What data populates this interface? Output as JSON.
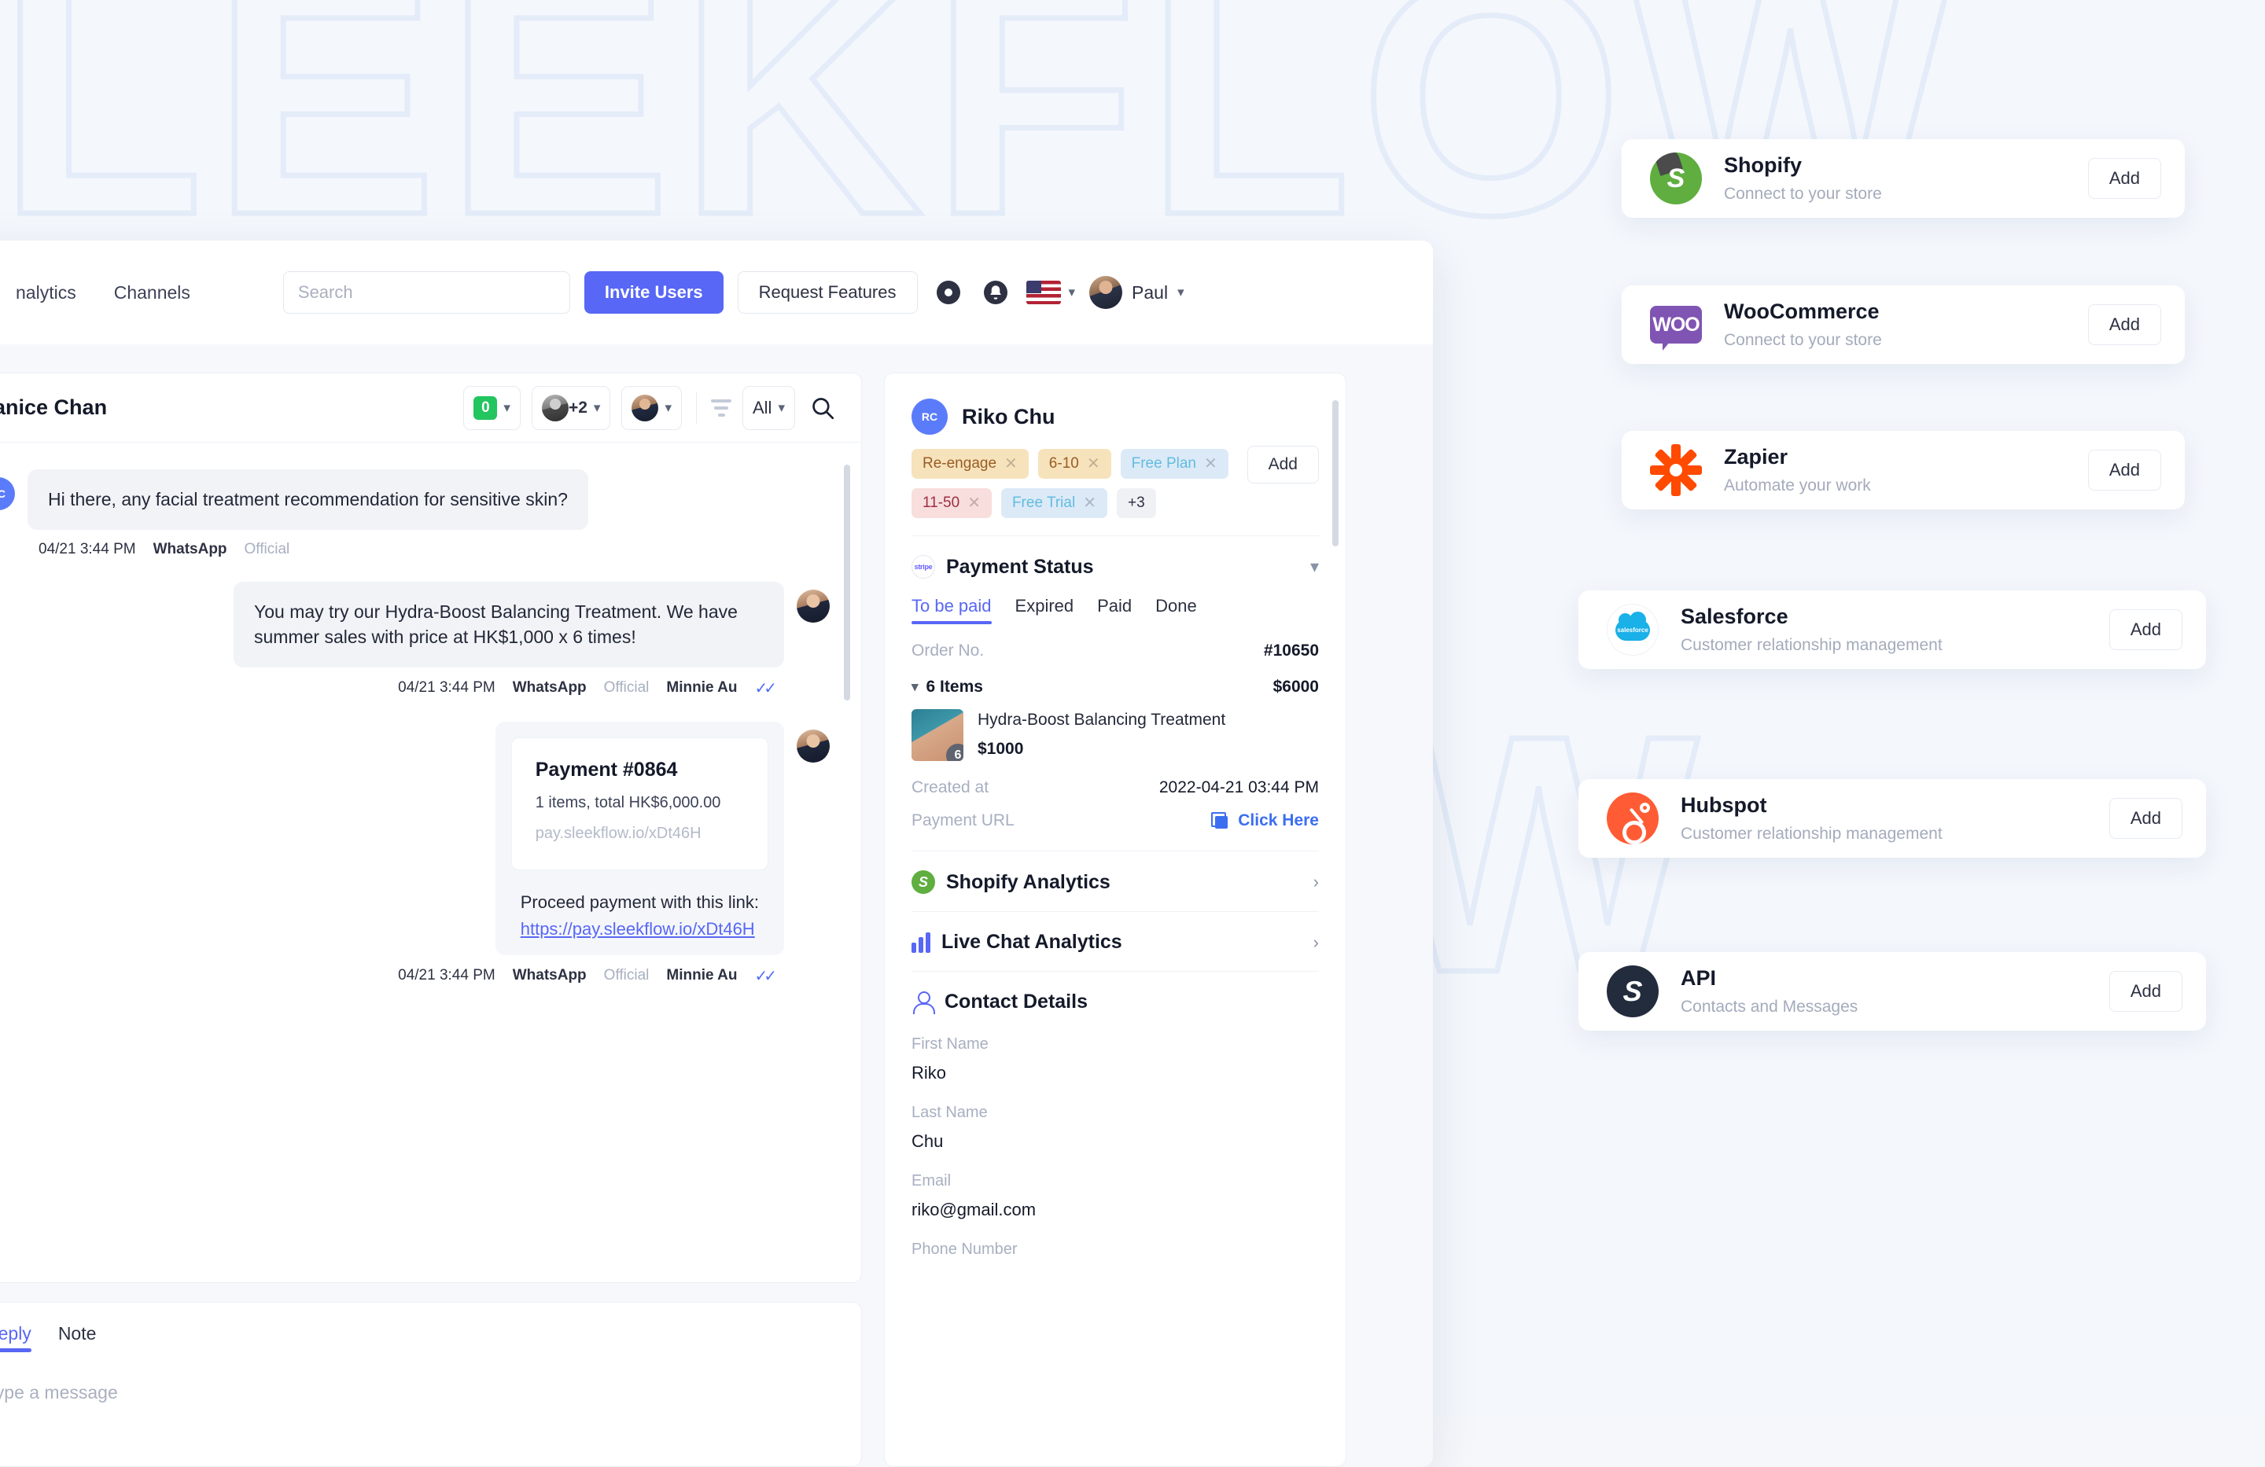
{
  "background": {
    "watermark_text": "SLEEKFLOW"
  },
  "topnav": {
    "links": [
      {
        "label": "nalytics",
        "name": "analytics"
      },
      {
        "label": "Channels",
        "name": "channels"
      }
    ],
    "search_placeholder": "Search",
    "search_value": "",
    "invite_users_label": "Invite Users",
    "request_features_label": "Request Features",
    "language_flag": "us-flag",
    "user_name": "Paul",
    "accent_color": "#5867f5"
  },
  "conversation": {
    "title": "Janice Chan",
    "channel_badge": "0",
    "assignees_extra": "+2",
    "filter_label": "All",
    "messages": [
      {
        "direction": "in",
        "avatar_initials": "JC",
        "text": "Hi there, any facial treatment recommendation for sensitive skin?",
        "time": "04/21 3:44 PM",
        "channel": "WhatsApp",
        "account": "Official",
        "agent": "",
        "read": false
      },
      {
        "direction": "out",
        "text": "You may try our Hydra-Boost Balancing Treatment. We have summer sales with price at HK$1,000 x 6 times!",
        "time": "04/21 3:44 PM",
        "channel": "WhatsApp",
        "account": "Official",
        "agent": "Minnie Au",
        "read": true
      }
    ],
    "payment_message": {
      "card_title": "Payment #0864",
      "card_subtitle": "1 items, total HK$6,000.00",
      "card_url": "pay.sleekflow.io/xDt46H",
      "body_text": "Proceed payment with this link:",
      "link_text": "https://pay.sleekflow.io/xDt46H",
      "time": "04/21 3:44 PM",
      "channel": "WhatsApp",
      "account": "Official",
      "agent": "Minnie Au"
    },
    "composer": {
      "tabs": [
        {
          "label": "Reply",
          "active": true
        },
        {
          "label": "Note",
          "active": false
        }
      ],
      "placeholder": "Type a message"
    }
  },
  "contact": {
    "avatar_initials": "RC",
    "name": "Riko Chu",
    "add_tag_label": "Add",
    "tags": [
      {
        "label": "Re-engage",
        "color": "amber"
      },
      {
        "label": "6-10",
        "color": "amber"
      },
      {
        "label": "Free Plan",
        "color": "blue"
      },
      {
        "label": "11-50",
        "color": "pink"
      },
      {
        "label": "Free Trial",
        "color": "blue"
      },
      {
        "label": "+3",
        "color": "grey"
      }
    ],
    "payment_status": {
      "section_title": "Payment Status",
      "tabs": [
        {
          "label": "To be paid",
          "active": true
        },
        {
          "label": "Expired",
          "active": false
        },
        {
          "label": "Paid",
          "active": false
        },
        {
          "label": "Done",
          "active": false
        }
      ],
      "order_no_label": "Order No.",
      "order_no_value": "#10650",
      "items_label": "6 Items",
      "items_total": "$6000",
      "item": {
        "name": "Hydra-Boost Balancing Treatment",
        "qty": "6",
        "price": "$1000"
      },
      "created_at_label": "Created at",
      "created_at_value": "2022-04-21 03:44 PM",
      "payment_url_label": "Payment URL",
      "payment_url_link": "Click Here"
    },
    "shopify_analytics_label": "Shopify Analytics",
    "live_chat_analytics_label": "Live Chat Analytics",
    "contact_details_label": "Contact Details",
    "fields": [
      {
        "label": "First Name",
        "value": "Riko"
      },
      {
        "label": "Last Name",
        "value": "Chu"
      },
      {
        "label": "Email",
        "value": "riko@gmail.com"
      },
      {
        "label": "Phone Number",
        "value": ""
      }
    ]
  },
  "integrations": {
    "add_label": "Add",
    "cards": [
      {
        "name": "Shopify",
        "desc": "Connect to your store",
        "logo": "shopify-logo"
      },
      {
        "name": "WooCommerce",
        "desc": "Connect to your store",
        "logo": "woocommerce-logo"
      },
      {
        "name": "Zapier",
        "desc": "Automate your work",
        "logo": "zapier-logo"
      },
      {
        "name": "Salesforce",
        "desc": "Customer relationship management",
        "logo": "salesforce-logo"
      },
      {
        "name": "Hubspot",
        "desc": "Customer relationship management",
        "logo": "hubspot-logo"
      },
      {
        "name": "API",
        "desc": "Contacts and Messages",
        "logo": "api-logo"
      }
    ]
  }
}
